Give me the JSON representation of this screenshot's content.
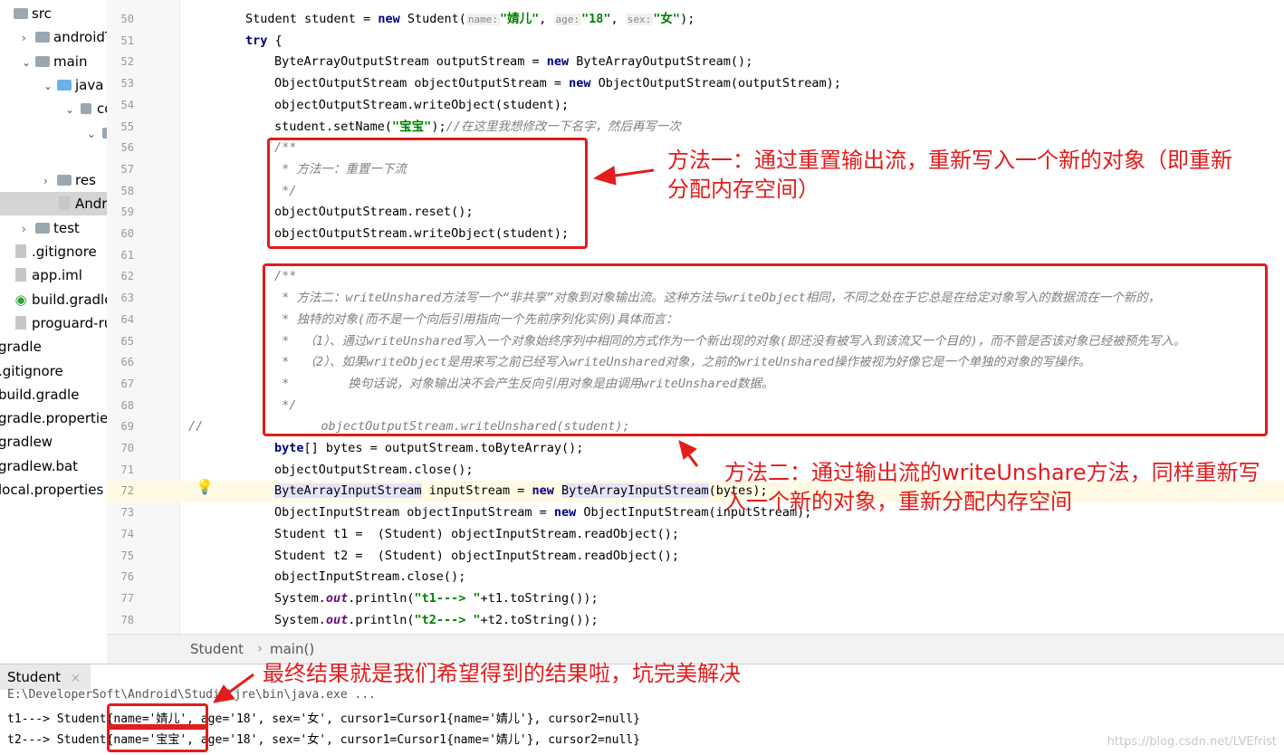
{
  "tree": {
    "items": [
      {
        "label": "src",
        "indent": 0,
        "arrow": "",
        "icon": "folder"
      },
      {
        "label": "androidTe",
        "indent": 1,
        "arrow": "›",
        "icon": "folder"
      },
      {
        "label": "main",
        "indent": 1,
        "arrow": "⌄",
        "icon": "folder"
      },
      {
        "label": "java",
        "indent": 2,
        "arrow": "⌄",
        "icon": "folder-blue"
      },
      {
        "label": "co",
        "indent": 3,
        "arrow": "⌄",
        "icon": "package"
      },
      {
        "label": "",
        "indent": 4,
        "arrow": "⌄",
        "icon": "package"
      },
      {
        "label": "",
        "indent": 5,
        "arrow": "⌄",
        "icon": ""
      },
      {
        "label": "res",
        "indent": 2,
        "arrow": "›",
        "icon": "folder"
      },
      {
        "label": "Andro",
        "indent": 2,
        "arrow": "",
        "icon": "file"
      },
      {
        "label": "test",
        "indent": 1,
        "arrow": "›",
        "icon": "folder"
      },
      {
        "label": ".gitignore",
        "indent": 0,
        "arrow": "",
        "icon": "file"
      },
      {
        "label": "app.iml",
        "indent": 0,
        "arrow": "",
        "icon": "file"
      },
      {
        "label": "build.gradle",
        "indent": 0,
        "arrow": "",
        "icon": "gradle"
      },
      {
        "label": "proguard-rul",
        "indent": 0,
        "arrow": "",
        "icon": "file"
      },
      {
        "label": "gradle",
        "indent": -1,
        "arrow": "",
        "icon": ""
      },
      {
        "label": ".gitignore",
        "indent": -1,
        "arrow": "",
        "icon": ""
      },
      {
        "label": "build.gradle",
        "indent": -1,
        "arrow": "",
        "icon": ""
      },
      {
        "label": "gradle.propertie",
        "indent": -1,
        "arrow": "",
        "icon": ""
      },
      {
        "label": "gradlew",
        "indent": -1,
        "arrow": "",
        "icon": ""
      },
      {
        "label": "gradlew.bat",
        "indent": -1,
        "arrow": "",
        "icon": ""
      },
      {
        "label": "local.properties",
        "indent": -1,
        "arrow": "",
        "icon": ""
      }
    ]
  },
  "editor": {
    "line_numbers": [
      "50",
      "51",
      "52",
      "53",
      "54",
      "55",
      "56",
      "57",
      "58",
      "59",
      "60",
      "61",
      "62",
      "63",
      "64",
      "65",
      "66",
      "67",
      "68",
      "69",
      "70",
      "71",
      "72",
      "73",
      "74",
      "75",
      "76",
      "77",
      "78"
    ],
    "lines": {
      "l50a": "Student student = ",
      "l50b": "new",
      "l50c": " Student(",
      "l50h1": "name:",
      "l50s1": "\"婧儿\"",
      "l50h2": "age:",
      "l50s2": "\"18\"",
      "l50h3": "sex:",
      "l50s3": "\"女\"",
      "l50d": ");",
      "l51": "try",
      "l51b": " {",
      "l52a": "ByteArrayOutputStream outputStream = ",
      "l52b": "new",
      "l52c": " ByteArrayOutputStream();",
      "l53a": "ObjectOutputStream objectOutputStream = ",
      "l53b": "new",
      "l53c": " ObjectOutputStream(outputStream);",
      "l54": "objectOutputStream.writeObject(student);",
      "l55a": "student.setName(",
      "l55b": "\"宝宝\"",
      "l55c": ");",
      "l55d": "//在这里我想修改一下名字，然后再写一次",
      "l56": "/**",
      "l57": " * 方法一：重置一下流",
      "l58": " */",
      "l59": "objectOutputStream.reset();",
      "l60": "objectOutputStream.writeObject(student);",
      "l62": "/**",
      "l63": " * 方法二：writeUnshared方法写一个“非共享”对象到对象输出流。这种方法与writeObject相同，不同之处在于它总是在给定对象写入的数据流在一个新的，",
      "l64": " * 独特的对象(而不是一个向后引用指向一个先前序列化实例)具体而言：",
      "l65": " *  （1）、通过writeUnshared写入一个对象始终序列中相同的方式作为一个新出现的对象(即还没有被写入到该流又一个目的)，而不管是否该对象已经被预先写入。",
      "l66": " *  （2）、如果writeObject是用来写之前已经写入writeUnshared对象，之前的writeUnshared操作被视为好像它是一个单独的对象的写操作。",
      "l67": " *        换句话说，对象输出决不会产生反向引用对象是由调用writeUnshared数据。",
      "l68": " */",
      "l69a": "//",
      "l69b": "objectOutputStream.writeUnshared(student);",
      "l70a": "byte",
      "l70b": "[] bytes = outputStream.toByteArray();",
      "l71": "objectOutputStream.close();",
      "l72a": "ByteArrayInputStream",
      "l72b": " inputStream = ",
      "l72c": "new",
      "l72d": " ",
      "l72e": "ByteArrayInputStream",
      "l72f": "(bytes);",
      "l73a": "ObjectInputStream objectInputStream = ",
      "l73b": "new",
      "l73c": " ObjectInputStream(inputStream);",
      "l74": "Student t1 =  (Student) objectInputStream.readObject();",
      "l75": "Student t2 =  (Student) objectInputStream.readObject();",
      "l76": "objectInputStream.close();",
      "l77a": "System.",
      "l77b": "out",
      "l77c": ".println(",
      "l77d": "\"t1---> \"",
      "l77e": "+t1.toString());",
      "l78a": "System.",
      "l78b": "out",
      "l78c": ".println(",
      "l78d": "\"t2---> \"",
      "l78e": "+t2.toString());"
    }
  },
  "breadcrumb": {
    "class": "Student",
    "separator": "›",
    "method": "main()"
  },
  "run": {
    "tab_label": "Student",
    "tab_close": "×",
    "cmd": "E:\\DeveloperSoft\\Android\\Studio\\jre\\bin\\java.exe ...",
    "out1": "t1---> Student{name='婧儿', age='18', sex='女', cursor1=Cursor1{name='婧儿'}, cursor2=null}",
    "out2": "t2---> Student{name='宝宝', age='18', sex='女', cursor1=Cursor1{name='婧儿'}, cursor2=null}"
  },
  "annotations": {
    "a1_l1": "方法一：通过重置输出流，重新写入一个新的对象（即重新",
    "a1_l2": "分配内存空间）",
    "a2_l1": "方法二：通过输出流的writeUnshare方法，同样重新写",
    "a2_l2": "入一个新的对象，重新分配内存空间",
    "a3": "最终结果就是我们希望得到的结果啦，坑完美解决",
    "color": "#e31c1c"
  },
  "watermark": "https://blog.csdn.net/LVEfrist"
}
